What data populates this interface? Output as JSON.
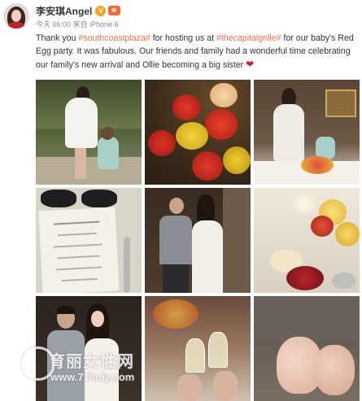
{
  "user": {
    "name": "李安琪Angel",
    "verified_mark": "V"
  },
  "meta": {
    "time": "今天 06:00",
    "source_prefix": "来自",
    "source": "iPhone 6"
  },
  "post": {
    "text_1": "Thank you ",
    "tag_1": "#southcoastplaza#",
    "text_2": " for hosting us at ",
    "tag_2": "#thecapitalgrille#",
    "text_3": " for our baby's Red Egg party. It was fabulous. Our friends and family had a wonderful time celebrating our family's new arrival and Ollie becoming a big sister ",
    "emoji": "heart"
  },
  "photos": [
    {
      "id": 1,
      "subject": "mother and daughter in garden"
    },
    {
      "id": 2,
      "subject": "red and yellow flower arrangement"
    },
    {
      "id": 3,
      "subject": "mother and daughter at dining room"
    },
    {
      "id": 4,
      "subject": "menu card with sunglasses"
    },
    {
      "id": 5,
      "subject": "couple toasting"
    },
    {
      "id": 6,
      "subject": "flowers and desserts"
    },
    {
      "id": 7,
      "subject": "couple portrait"
    },
    {
      "id": 8,
      "subject": "champagne glasses"
    },
    {
      "id": 9,
      "subject": "baby feet"
    }
  ],
  "watermark": {
    "cn": "育丽女性网",
    "url": "www.71lady.com"
  },
  "colors": {
    "tag": "#eb7350",
    "heart": "#d0202c",
    "verified": "#f7a21b"
  }
}
